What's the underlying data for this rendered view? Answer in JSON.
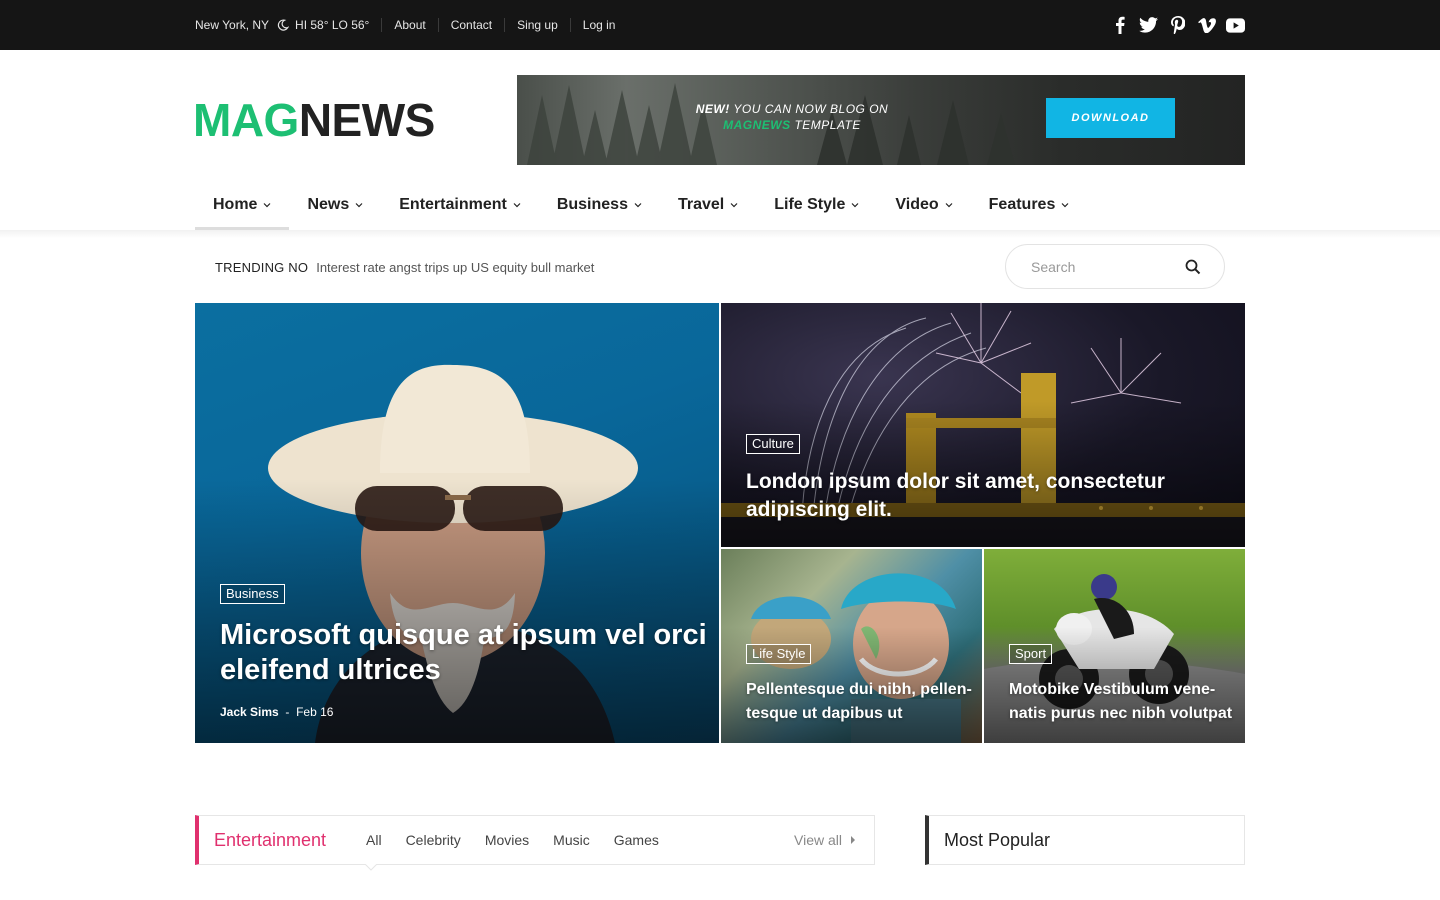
{
  "topbar": {
    "location": "New York, NY",
    "weather": "HI 58° LO 56°",
    "links": [
      "About",
      "Contact",
      "Sing up",
      "Log in"
    ],
    "social_icons": [
      "facebook-icon",
      "twitter-icon",
      "pinterest-icon",
      "vimeo-icon",
      "youtube-icon"
    ]
  },
  "logo": {
    "part1": "MAG",
    "part2": "NEWS"
  },
  "banner": {
    "new_label": "NEW!",
    "line1": "YOU CAN NOW BLOG ON",
    "brand": "MAGNEWS",
    "line2": "TEMPLATE",
    "button": "DOWNLOAD"
  },
  "nav": {
    "items": [
      "Home",
      "News",
      "Entertainment",
      "Business",
      "Travel",
      "Life Style",
      "Video",
      "Features"
    ],
    "active": "Home"
  },
  "trending": {
    "label": "TRENDING NO",
    "headline": "Interest rate angst trips up US equity bull market"
  },
  "search": {
    "placeholder": "Search"
  },
  "hero": {
    "main": {
      "category": "Business",
      "title_line1": "Microsoft quisque at ipsum vel orci",
      "title_line2": "eleifend ultrices",
      "author": "Jack Sims",
      "date": "Feb 16"
    },
    "top_right": {
      "category": "Culture",
      "title_line1": "London ipsum dolor sit amet, consectetur",
      "title_line2": "adipiscing elit."
    },
    "bottom_left": {
      "category": "Life Style",
      "title_line1": "Pellentesque dui nibh, pellen-",
      "title_line2": "tesque ut dapibus ut"
    },
    "bottom_right": {
      "category": "Sport",
      "title_line1": "Motobike Vestibulum vene-",
      "title_line2": "natis purus nec nibh volutpat"
    }
  },
  "entertainment": {
    "title": "Entertainment",
    "tabs": [
      "All",
      "Celebrity",
      "Movies",
      "Music",
      "Games"
    ],
    "view_all": "View all",
    "accent": "#e0306e"
  },
  "most_popular": {
    "title": "Most Popular"
  },
  "colors": {
    "brand_green": "#1dbf73",
    "download_blue": "#11b5e4",
    "topbar_bg": "#151515"
  }
}
